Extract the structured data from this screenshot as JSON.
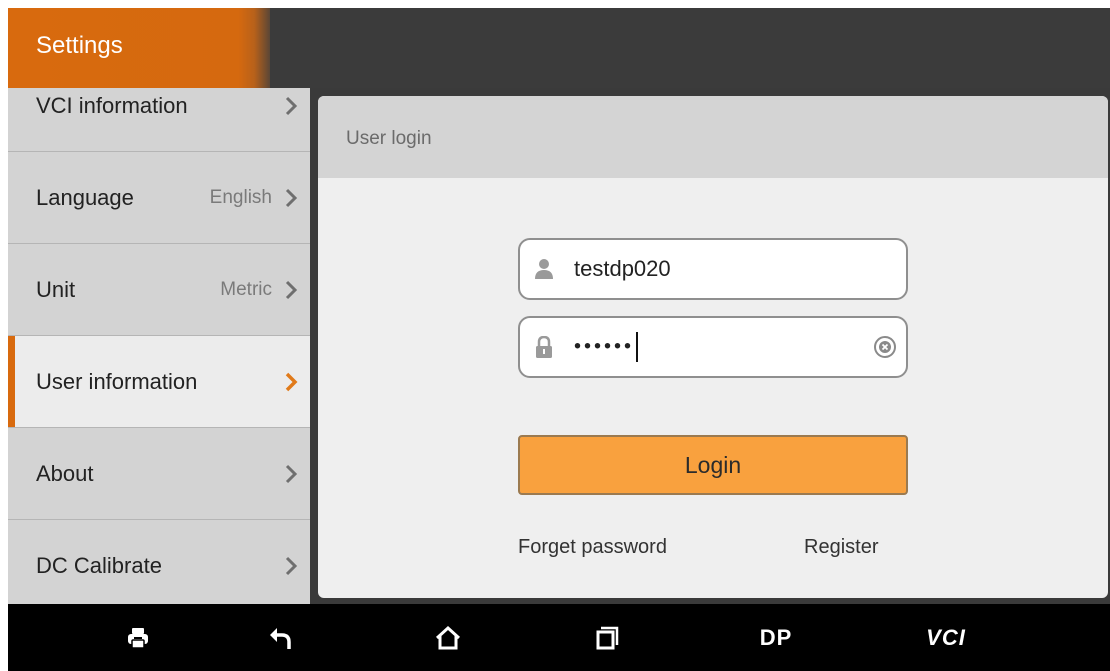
{
  "titlebar": {
    "title": "Settings"
  },
  "sidebar": {
    "items": [
      {
        "label": "VCI information",
        "value": ""
      },
      {
        "label": "Language",
        "value": "English"
      },
      {
        "label": "Unit",
        "value": "Metric"
      },
      {
        "label": "User information",
        "value": ""
      },
      {
        "label": "About",
        "value": ""
      },
      {
        "label": "DC Calibrate",
        "value": ""
      }
    ],
    "active_label": "User information"
  },
  "login": {
    "title": "User login",
    "username": "testdp020",
    "password_masked": "••••••",
    "login_label": "Login",
    "forget_label": "Forget password",
    "register_label": "Register"
  },
  "navbar": {
    "items": [
      {
        "name": "print-icon"
      },
      {
        "name": "back-icon"
      },
      {
        "name": "home-icon"
      },
      {
        "name": "recent-apps-icon"
      },
      {
        "label": "DP"
      },
      {
        "label": "VCI"
      }
    ]
  },
  "colors": {
    "accent": "#d86a0e",
    "login_button": "#f9a13e",
    "sidebar_bg": "#d3d3d3",
    "navbar_bg": "#000000"
  }
}
